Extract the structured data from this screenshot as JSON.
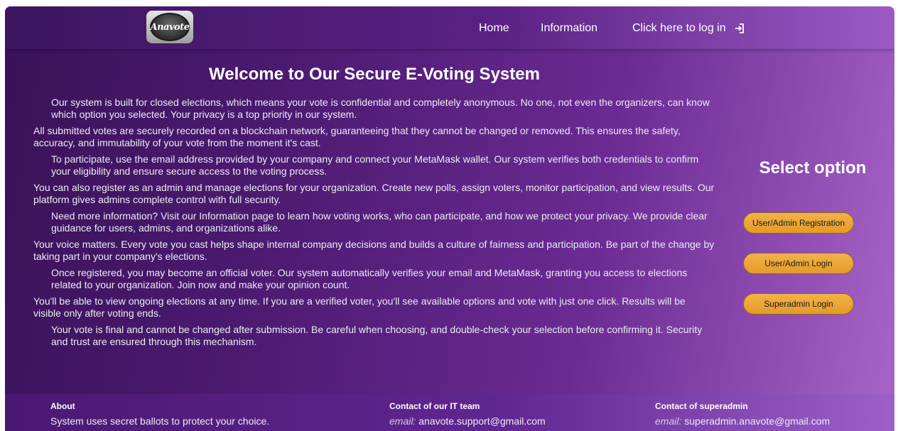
{
  "logo": {
    "text": "Anavote"
  },
  "nav": {
    "home": "Home",
    "information": "Information",
    "login": "Click here to log in"
  },
  "main": {
    "title": "Welcome to Our Secure E-Voting System",
    "paragraphs": [
      "Our system is built for closed elections, which means your vote is confidential and completely anonymous. No one, not even the organizers, can know which option you selected. Your privacy is a top priority in our system.",
      "All submitted votes are securely recorded on a blockchain network, guaranteeing that they cannot be changed or removed. This ensures the safety, accuracy, and immutability of your vote from the moment it's cast.",
      "To participate, use the email address provided by your company and connect your MetaMask wallet. Our system verifies both credentials to confirm your eligibility and ensure secure access to the voting process.",
      "You can also register as an admin and manage elections for your organization. Create new polls, assign voters, monitor participation, and view results. Our platform gives admins complete control with full security.",
      "Need more information? Visit our Information page to learn how voting works, who can participate, and how we protect your privacy. We provide clear guidance for users, admins, and organizations alike.",
      "Your voice matters. Every vote you cast helps shape internal company decisions and builds a culture of fairness and participation. Be part of the change by taking part in your company's elections.",
      "Once registered, you may become an official voter. Our system automatically verifies your email and MetaMask, granting you access to elections related to your organization. Join now and make your opinion count.",
      "You'll be able to view ongoing elections at any time. If you are a verified voter, you'll see available options and vote with just one click. Results will be visible only after voting ends.",
      "Your vote is final and cannot be changed after submission. Be careful when choosing, and double-check your selection before confirming it. Security and trust are ensured through this mechanism."
    ]
  },
  "side": {
    "title": "Select option",
    "buttons": {
      "registration": "User/Admin Registration",
      "login": "User/Admin Login",
      "superadmin": "Superadmin Login"
    }
  },
  "footer": {
    "about": {
      "heading": "About",
      "text": "System uses secret ballots to protect your choice."
    },
    "it": {
      "heading": "Contact of our IT team",
      "label": "email:",
      "email": "anavote.support@gmail.com"
    },
    "superadmin": {
      "heading": "Contact of superadmin",
      "label": "email:",
      "email": "superadmin.anavote@gmail.com"
    }
  },
  "colors": {
    "accent_button": "#f3b248",
    "background_dark": "#3a1258",
    "background_light": "#a865c9"
  },
  "icons": {
    "login": "login-arrow-icon"
  }
}
